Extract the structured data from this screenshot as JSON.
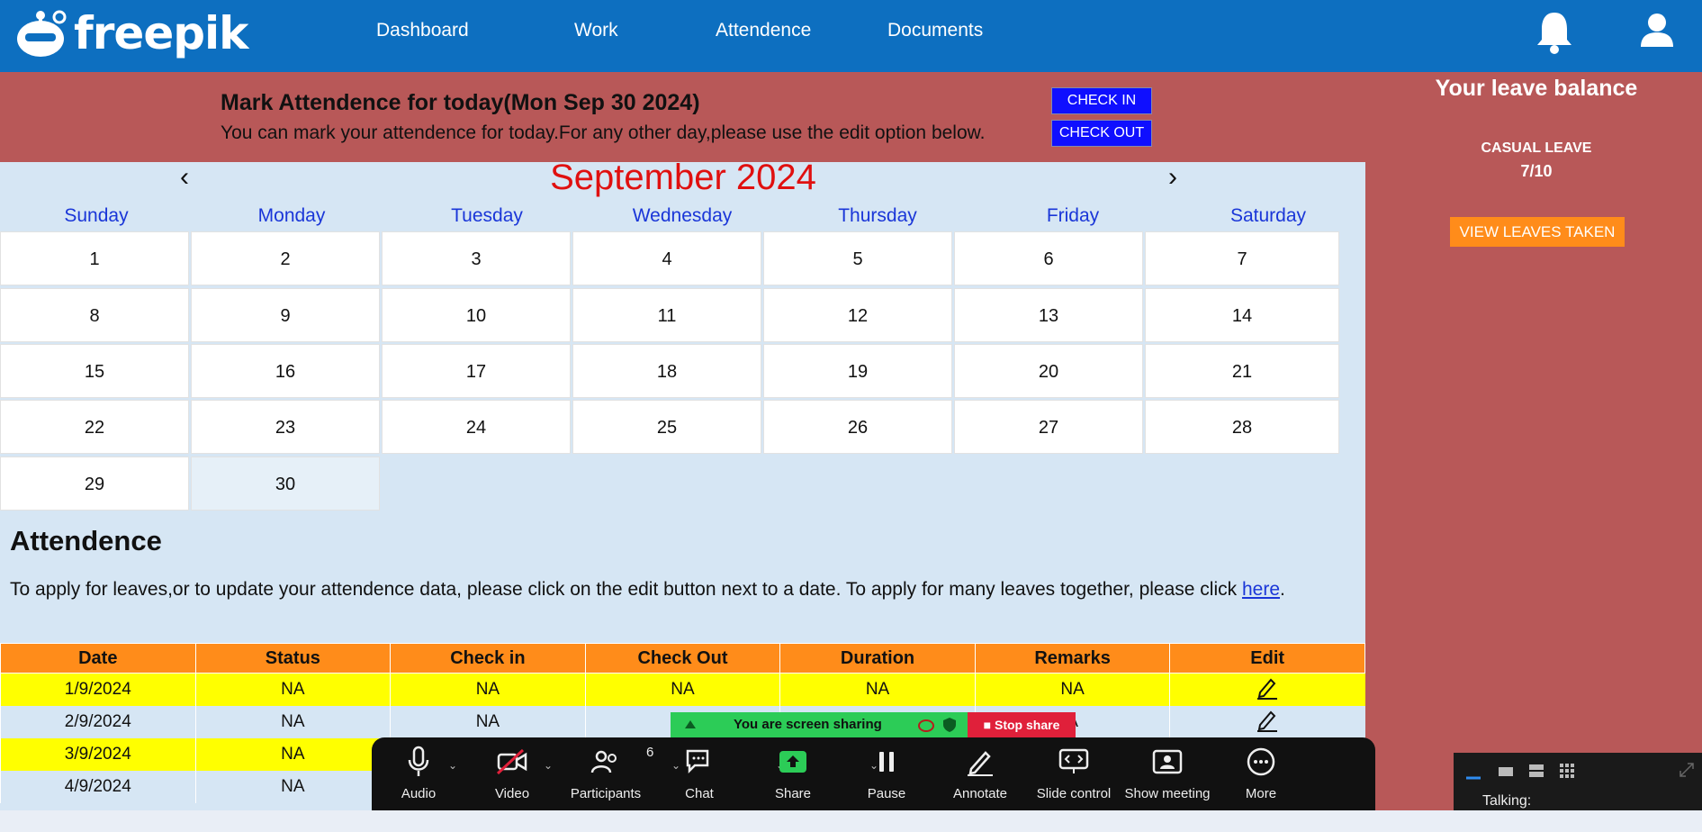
{
  "header": {
    "logo_text": "freepik",
    "nav": [
      "Dashboard",
      "Work",
      "Attendence",
      "Documents"
    ],
    "icons": [
      "bell-icon",
      "user-icon"
    ]
  },
  "mark": {
    "title": "Mark Attendence for today(Mon Sep 30 2024)",
    "subtitle": "You can mark your attendence for today.For any other day,please use the edit option below.",
    "check_in": "CHECK IN",
    "check_out": "CHECK OUT"
  },
  "leave": {
    "title": "Your leave balance",
    "type": "CASUAL LEAVE",
    "value": "7/10",
    "button": "VIEW LEAVES TAKEN"
  },
  "calendar": {
    "month": "September 2024",
    "prev": "‹",
    "next": "›",
    "days": [
      "Sunday",
      "Monday",
      "Tuesday",
      "Wednesday",
      "Thursday",
      "Friday",
      "Saturday"
    ],
    "weeks": [
      [
        "1",
        "2",
        "3",
        "4",
        "5",
        "6",
        "7"
      ],
      [
        "8",
        "9",
        "10",
        "11",
        "12",
        "13",
        "14"
      ],
      [
        "15",
        "16",
        "17",
        "18",
        "19",
        "20",
        "21"
      ],
      [
        "22",
        "23",
        "24",
        "25",
        "26",
        "27",
        "28"
      ],
      [
        "29",
        "30"
      ]
    ]
  },
  "attendance": {
    "heading": "Attendence",
    "description": "To apply for leaves,or to update your attendence data, please click on the edit button next to a date. To apply for many leaves together, please click",
    "link": "here",
    "columns": [
      "Date",
      "Status",
      "Check in",
      "Check Out",
      "Duration",
      "Remarks",
      "Edit"
    ],
    "rows": [
      [
        "1/9/2024",
        "NA",
        "NA",
        "NA",
        "NA",
        "NA"
      ],
      [
        "2/9/2024",
        "NA",
        "NA",
        "",
        "",
        "A"
      ],
      [
        "3/9/2024",
        "NA",
        "",
        "",
        "",
        ""
      ],
      [
        "4/9/2024",
        "NA",
        "",
        "",
        "",
        ""
      ]
    ]
  },
  "zoom": {
    "sharing_text": "You are screen sharing",
    "stop_share": "Stop share",
    "participants_count": "6",
    "controls": [
      "Audio",
      "Video",
      "Participants",
      "Chat",
      "Share",
      "Pause",
      "Annotate",
      "Slide control",
      "Show meeting",
      "More"
    ],
    "talking_label": "Talking:"
  }
}
